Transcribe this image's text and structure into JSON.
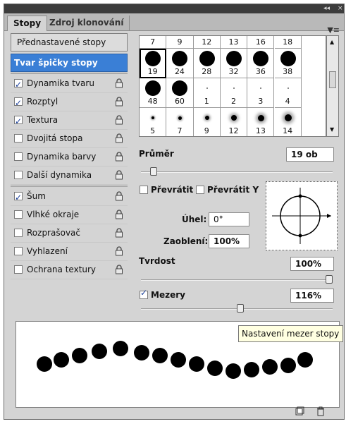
{
  "window": {
    "collapse_glyph": "◂◂",
    "close_glyph": "×"
  },
  "tabs": [
    {
      "label": "Stopy",
      "active": true
    },
    {
      "label": "Zdroj klonování",
      "active": false
    }
  ],
  "presets_label": "Přednastavené stopy",
  "settings": [
    {
      "label": "Tvar špičky stopy",
      "selected": true,
      "checkbox": false,
      "lock": false
    },
    {
      "label": "Dynamika tvaru",
      "checked": true,
      "checkbox": true,
      "lock": true
    },
    {
      "label": "Rozptyl",
      "checked": true,
      "checkbox": true,
      "lock": true
    },
    {
      "label": "Textura",
      "checked": true,
      "checkbox": true,
      "lock": true
    },
    {
      "label": "Dvojitá stopa",
      "checked": false,
      "checkbox": true,
      "lock": true
    },
    {
      "label": "Dynamika barvy",
      "checked": false,
      "checkbox": true,
      "lock": true
    },
    {
      "label": "Další dynamika",
      "checked": false,
      "checkbox": true,
      "lock": true
    },
    {
      "label": "Šum",
      "checked": true,
      "checkbox": true,
      "lock": true
    },
    {
      "label": "Vlhké okraje",
      "checked": false,
      "checkbox": true,
      "lock": true
    },
    {
      "label": "Rozprašovač",
      "checked": false,
      "checkbox": true,
      "lock": true
    },
    {
      "label": "Vyhlazení",
      "checked": false,
      "checkbox": true,
      "lock": true
    },
    {
      "label": "Ochrana textury",
      "checked": false,
      "checkbox": true,
      "lock": true
    }
  ],
  "brush_grid": {
    "header_row": [
      "7",
      "9",
      "12",
      "13",
      "16",
      "18"
    ],
    "rows": [
      {
        "labels": [
          "19",
          "24",
          "28",
          "32",
          "36",
          "38"
        ],
        "dot": "large"
      },
      {
        "labels": [
          "48",
          "60",
          "1",
          "2",
          "3",
          "4"
        ],
        "dot": "mixed"
      },
      {
        "labels": [
          "5",
          "7",
          "9",
          "12",
          "13",
          "14"
        ],
        "dot": "soft"
      }
    ],
    "selected_label": "19"
  },
  "diameter": {
    "label": "Průměr",
    "value": "19 ob",
    "slider": 0.05
  },
  "flip_x": {
    "label": "Převrátit X",
    "checked": false
  },
  "flip_y": {
    "label": "Převrátit Y",
    "checked": false
  },
  "angle": {
    "label": "Úhel:",
    "value": "0°"
  },
  "roundness": {
    "label": "Zaoblení:",
    "value": "100%"
  },
  "hardness": {
    "label": "Tvrdost",
    "value": "100%",
    "slider": 1.0
  },
  "spacing": {
    "label": "Mezery",
    "checked": true,
    "value": "116%",
    "slider": 0.52
  },
  "tooltip": "Nastavení mezer stopy",
  "bottom_icons": [
    "new-preset-icon",
    "trash-icon"
  ]
}
